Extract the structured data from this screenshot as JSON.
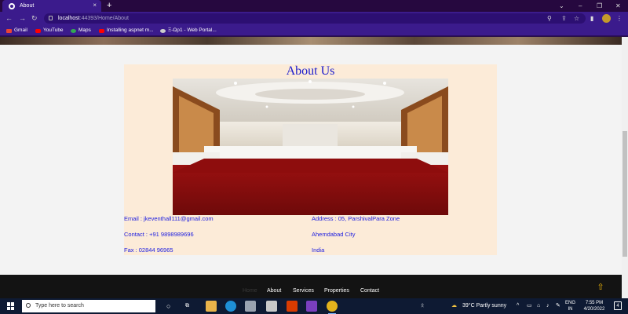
{
  "browser": {
    "tab_title": "About",
    "tab_close": "×",
    "new_tab": "+",
    "url_host": "localhost",
    "url_path": ":44393/Home/About",
    "bookmarks": [
      "Gmail",
      "YouTube",
      "Maps",
      "Installing aspnet m...",
      "Ξ-Ωρ1 - Web Portal..."
    ]
  },
  "page": {
    "heading": "About Us",
    "email": "Email : jkeventhall111@gmail.com",
    "contact": "Contact : +91 9898989696",
    "fax": "Fax : 02844 96965",
    "address": "Address : 05, ParshivalPara Zone",
    "city": "Ahemdabad City",
    "country": "India",
    "image_alt": "banquet-hall-photo"
  },
  "footer": {
    "links": [
      "Home",
      "About",
      "Services",
      "Properties",
      "Contact"
    ]
  },
  "taskbar": {
    "search_placeholder": "Type here to search",
    "weather": "39°C  Partly sunny",
    "lang_top": "ENG",
    "lang_bottom": "IN",
    "time": "7:55 PM",
    "date": "4/20/2022",
    "notif_count": "4"
  },
  "colors": {
    "browser_bg": "#3b1b8c",
    "about_bg": "#fcebd8",
    "link_blue": "#2020e0",
    "heading_blue": "#1a1acc",
    "footer_bg": "#131313"
  }
}
